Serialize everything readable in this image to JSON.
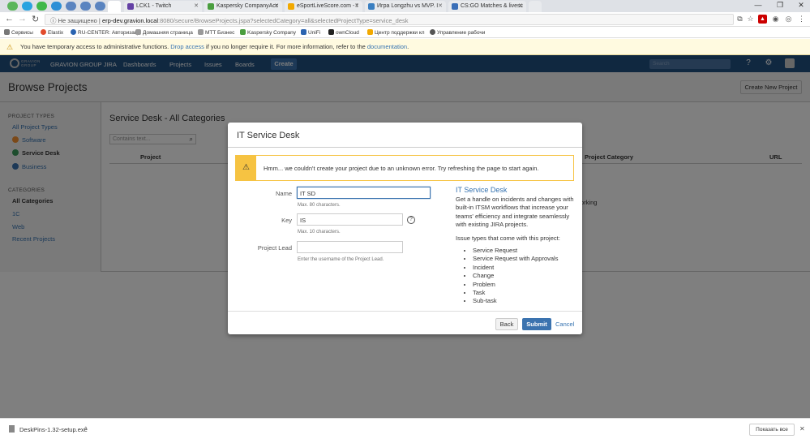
{
  "browser": {
    "tabs": [
      {
        "label": "LCK1 - Twitch",
        "color": "#6441a5"
      },
      {
        "label": "Kaspersky CompanyAcc",
        "color": "#4a9e3f"
      },
      {
        "label": "eSportLiveScore.com - I",
        "color": "#f2a900"
      },
      {
        "label": "Игра Longzhu vs MVP. I",
        "color": "#3a7fc1"
      },
      {
        "label": "CS:GO Matches & livesc",
        "color": "#3a6fb8"
      }
    ],
    "security_label": "Не защищено",
    "url_host": "erp-dev.gravion.local",
    "url_path": ":8080/secure/BrowseProjects.jspa?selectedCategory=all&selectedProjectType=service_desk",
    "bookmarks": [
      "Сервисы",
      "Elastix",
      "RU-CENTER: Авторизац",
      "Домашняя страница",
      "MTT Бизнес",
      "Kaspersky Company",
      "UniFi",
      "ownCloud",
      "Центр поддержки кл",
      "Управление рабочи"
    ]
  },
  "warning": {
    "text_before": "You have temporary access to administrative functions.",
    "link1": "Drop access",
    "text_middle": "if you no longer require it. For more information, refer to the",
    "link2": "documentation",
    "text_after": "."
  },
  "jira_header": {
    "logo_top": "GRAVION",
    "logo_bottom": "GROUP",
    "app_name": "GRAVION GROUP JIRA",
    "nav": [
      "Dashboards",
      "Projects",
      "Issues",
      "Boards"
    ],
    "create_label": "Create",
    "search_placeholder": "Search"
  },
  "page": {
    "title": "Browse Projects",
    "create_project_label": "Create New Project"
  },
  "sidebar": {
    "project_types_heading": "PROJECT TYPES",
    "project_types": [
      {
        "label": "All Project Types",
        "color": ""
      },
      {
        "label": "Software",
        "color": "#f79232"
      },
      {
        "label": "Service Desk",
        "color": "#59afe1"
      },
      {
        "label": "Business",
        "color": "#3b73af"
      }
    ],
    "categories_heading": "CATEGORIES",
    "categories": [
      "All Categories",
      "1C",
      "Web",
      "Recent Projects"
    ]
  },
  "main": {
    "title": "Service Desk - All Categories",
    "filter_placeholder": "Contains text...",
    "columns": [
      "Project",
      "Project Category",
      "URL"
    ],
    "row_fragment": "orking"
  },
  "dialog": {
    "title": "IT Service Desk",
    "error": "Hmm... we couldn't create your project due to an unknown error. Try refreshing the page to start again.",
    "fields": {
      "name_label": "Name",
      "name_value": "IT SD",
      "name_hint": "Max. 80 characters.",
      "key_label": "Key",
      "key_value": "IS",
      "key_hint": "Max. 10 characters.",
      "lead_label": "Project Lead",
      "lead_value": "",
      "lead_hint": "Enter the username of the Project Lead."
    },
    "info_title": "IT Service Desk",
    "info_desc": "Get a handle on incidents and changes with built-in ITSM workflows that increase your teams' efficiency and integrate seamlessly with existing JIRA projects.",
    "issue_types_heading": "Issue types that come with this project:",
    "issue_types": [
      "Service Request",
      "Service Request with Approvals",
      "Incident",
      "Change",
      "Problem",
      "Task",
      "Sub-task"
    ],
    "back_label": "Back",
    "submit_label": "Submit",
    "cancel_label": "Cancel"
  },
  "download_bar": {
    "file": "DeskPins-1.32-setup.exe",
    "show_all": "Показать все"
  }
}
